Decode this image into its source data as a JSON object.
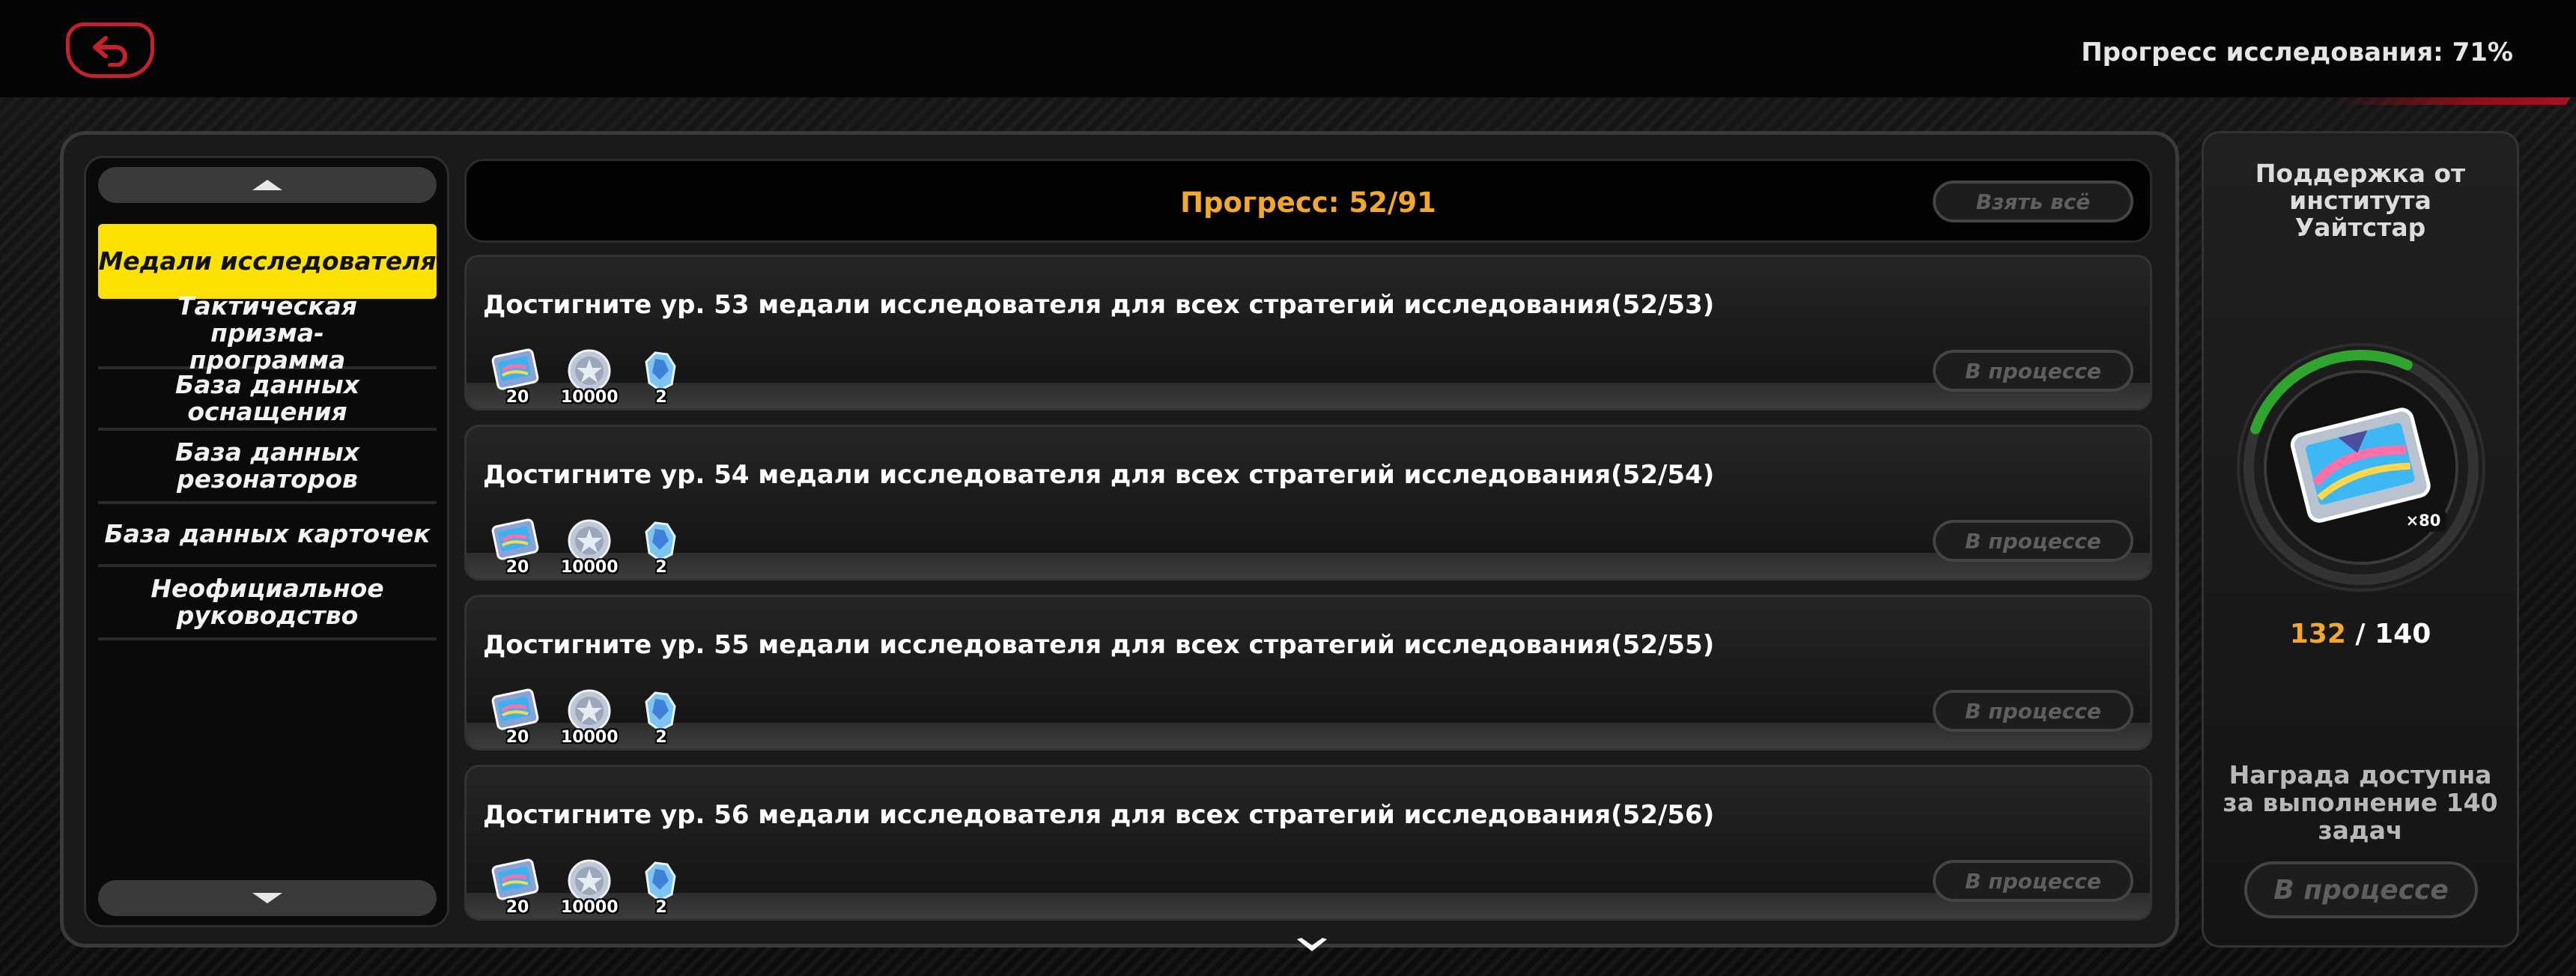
{
  "header": {
    "research_progress": "Прогресс исследования: 71%"
  },
  "nav": {
    "items": [
      {
        "label": "Медали исследователя",
        "active": true
      },
      {
        "label": "Тактическая призма-программа",
        "active": false
      },
      {
        "label": "База данных оснащения",
        "active": false
      },
      {
        "label": "База данных резонаторов",
        "active": false
      },
      {
        "label": "База данных карточек",
        "active": false
      },
      {
        "label": "Неофициальное руководство",
        "active": false
      }
    ]
  },
  "main": {
    "progress_label": "Прогресс: 52/91",
    "claim_all_label": "Взять всё",
    "tasks": [
      {
        "title": "Достигните ур. 53 медали исследователя для всех стратегий исследования(52/53)",
        "status": "В процессе"
      },
      {
        "title": "Достигните ур. 54 медали исследователя для всех стратегий исследования(52/54)",
        "status": "В процессе"
      },
      {
        "title": "Достигните ур. 55 медали исследователя для всех стратегий исследования(52/55)",
        "status": "В процессе"
      },
      {
        "title": "Достигните ур. 56 медали исследователя для всех стратегий исследования(52/56)",
        "status": "В процессе"
      }
    ],
    "rewards": [
      {
        "icon": "film-reel-icon",
        "count": "20"
      },
      {
        "icon": "silver-coin-icon",
        "count": "10000"
      },
      {
        "icon": "crystal-material-icon",
        "count": "2"
      }
    ]
  },
  "side": {
    "title": "Поддержка от института Уайтстар",
    "reward_multiplier": "×80",
    "current": "132",
    "separator_total": " / 140",
    "progress_fraction": 0.943,
    "note": "Награда доступна за выполнение 140 задач",
    "status_label": "В процессе"
  },
  "colors": {
    "accent_yellow": "#fae100",
    "progress_orange": "#f4a82b",
    "back_red": "#c4212c",
    "ring_green": "#2fa52f"
  }
}
